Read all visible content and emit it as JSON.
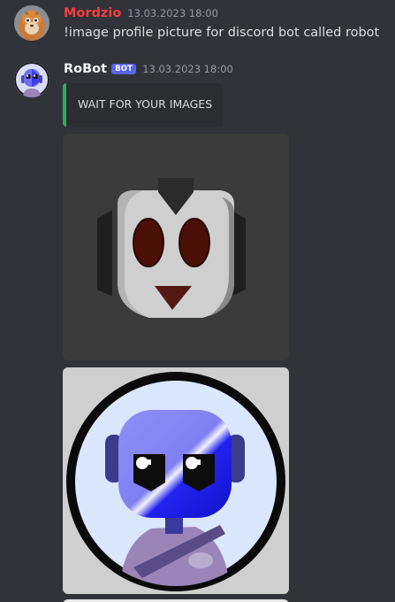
{
  "messages": [
    {
      "author": "Mordzio",
      "author_color": "#f23f42",
      "timestamp": "13.03.2023 18:00",
      "text": "!image profile picture for discord bot called robot"
    },
    {
      "author": "RoBot",
      "author_color": "#f2f3f5",
      "bot_tag": "BOT",
      "timestamp": "13.03.2023 18:00",
      "embed_text": "WAIT FOR YOUR IMAGES",
      "embed_color": "#2fab61"
    }
  ],
  "colors": {
    "background": "#313338",
    "embed_background": "#2b2d31",
    "bot_tag": "#5865f2",
    "timestamp": "#949ba4"
  },
  "icons": [
    "mordzio-avatar",
    "robot-avatar",
    "robot-image-attachment-1",
    "robot-image-attachment-2"
  ]
}
